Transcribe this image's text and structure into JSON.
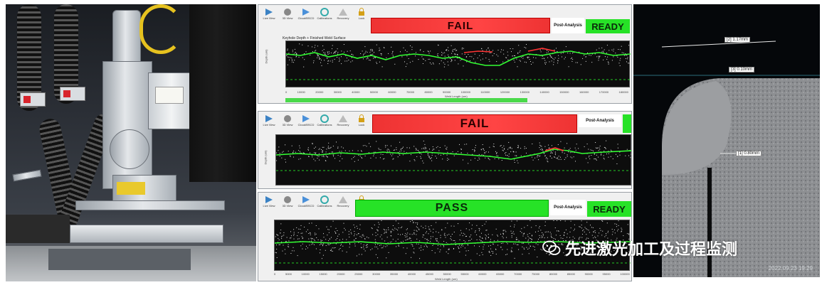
{
  "panel_top": {
    "toolbar": [
      "Live View",
      "3D View",
      "Cloud/BSCD",
      "Calibrations",
      "Recovery",
      "Lock"
    ],
    "status": "FAIL",
    "post_analysis": "Post-Analysis",
    "ready": "READY",
    "plot_title": "Keyhole Depth + Finished Weld Surface",
    "ylabel": "Depth (um)",
    "xlabel": "Weld Length (um)",
    "x_ticks": [
      "0",
      "10000",
      "20000",
      "30000",
      "40000",
      "50000",
      "60000",
      "70000",
      "80000",
      "90000",
      "100000",
      "110000",
      "120000",
      "130000",
      "140000",
      "150000",
      "160000",
      "170000",
      "180000"
    ],
    "y_ticks": [
      "600",
      "400",
      "200",
      "0",
      "-200",
      "-400",
      "-600",
      "-800",
      "-1000"
    ],
    "colors": {
      "fail": "#ee3333",
      "ready": "#27e227",
      "trace": "#33ff33",
      "points": "#e8e8e8"
    }
  },
  "panel_mid": {
    "toolbar": [
      "Live View",
      "3D View",
      "Cloud/BSCD",
      "Calibrations",
      "Recovery",
      "Lock"
    ],
    "status": "FAIL",
    "post_analysis": "Post-Analysis",
    "ylabel": "Depth (um)"
  },
  "panel_bottom": {
    "toolbar": [
      "Live View",
      "3D View",
      "Cloud/BSCD",
      "Calibrations",
      "Recovery",
      "Lock"
    ],
    "status": "PASS",
    "post_analysis": "Post-Analysis",
    "ready": "READY",
    "xlabel": "Weld Length (um)",
    "x_ticks": [
      "0",
      "5000",
      "10000",
      "15000",
      "20000",
      "25000",
      "30000",
      "35000",
      "40000",
      "45000",
      "50000",
      "55000",
      "60000",
      "65000",
      "70000",
      "75000",
      "80000",
      "85000",
      "90000",
      "95000",
      "100000"
    ],
    "y_ticks": [
      "400",
      "200",
      "0",
      "-200",
      "-400",
      "-600",
      "-800",
      "-1000",
      "-1200",
      "-1400"
    ]
  },
  "micro": {
    "measurements": [
      "[2] 1.17mm",
      "[3] 0.10mm",
      "[1] 0.80mm"
    ],
    "timestamp": "2022.09.23  19:29"
  },
  "watermark": {
    "text": "先进激光加工及过程监测",
    "icon": "wechat-icon"
  }
}
